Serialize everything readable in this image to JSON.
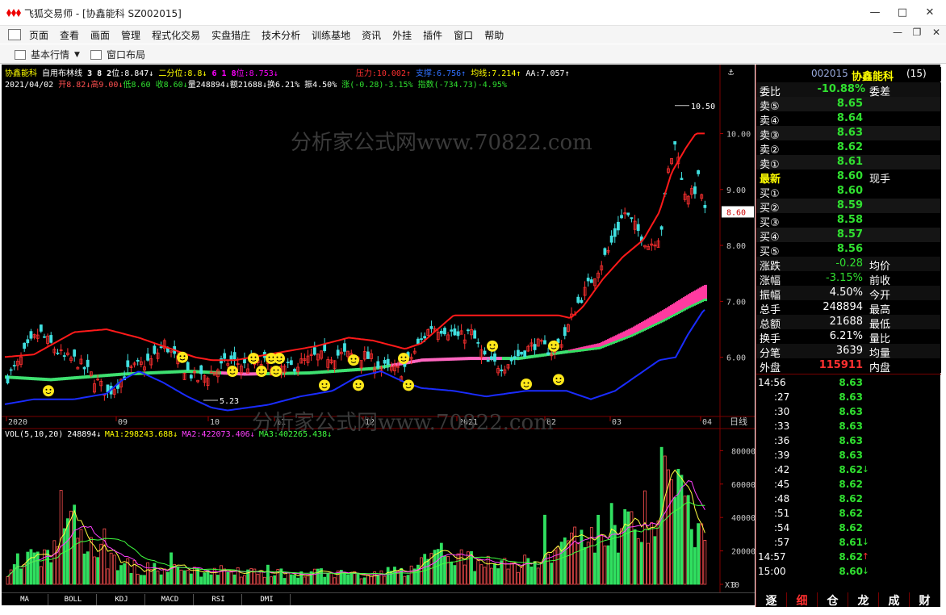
{
  "window": {
    "title": "飞狐交易师 - [协鑫能科 SZ002015]",
    "minimize": "—",
    "maximize": "□",
    "close": "✕",
    "restore": "❐",
    "inner_close": "✕"
  },
  "menu": {
    "items": [
      "页面",
      "查看",
      "画面",
      "管理",
      "程式化交易",
      "实盘猎庄",
      "技术分析",
      "训练基地",
      "资讯",
      "外挂",
      "插件",
      "窗口",
      "帮助"
    ]
  },
  "toolbar": {
    "basic_quote": "基本行情",
    "window_layout": "窗口布局"
  },
  "chart": {
    "info1": {
      "name": "协鑫能科",
      "indicator": "自用布林线",
      "pos1_label": "3 8 2",
      "pos1_value": "位:8.847↓",
      "pos2": "二分位:8.8↓",
      "pos3_label": "6 1 8",
      "pos3_value": "位:8.753↓",
      "pressure": "压力:10.002↑",
      "support": "支撑:6.756↑",
      "ma": "均线:7.214↑",
      "aa": "AA:7.057↑"
    },
    "info2": {
      "date": "2021/04/02",
      "open": "开8.82↓",
      "high": "高9.00↓",
      "low": "低8.60",
      "close": "收8.60↓",
      "volume": "量248894↓",
      "amount": "额21688↓",
      "turnover": "换6.21%",
      "amplitude": "振4.50%",
      "change": "涨(-0.28)-3.15%",
      "index": "指数(-734.73)-4.95%"
    },
    "price_axis": [
      "10.00",
      "9.00",
      "8.00",
      "7.00",
      "6.00"
    ],
    "current_price_tag": "8.60",
    "high_label": "10.50",
    "low_label": "5.23",
    "date_axis": [
      "2020",
      "09",
      "10",
      "11",
      "12",
      "2021",
      "02",
      "03",
      "04"
    ],
    "period_label": "日线",
    "watermark": "分析家公式网www.70822.com",
    "vol_info": {
      "label": "VOL(5,10,20)",
      "value": "248894↓",
      "ma1": "MA1:298243.688↓",
      "ma2": "MA2:422073.406↓",
      "ma3": "MA3:402265.438↓"
    },
    "vol_axis": [
      "80000",
      "60000",
      "40000",
      "20000",
      "0"
    ],
    "vol_unit": "X10",
    "chart_data": {
      "type": "candlestick",
      "ylim": [
        5.0,
        10.8
      ],
      "x_start": "2020",
      "x_end": "2021-04-02",
      "last_close": 8.6,
      "high": 10.5,
      "low": 5.23,
      "band": {
        "upper_last": 10.002,
        "lower_last": 6.756,
        "mid_last": 7.214
      },
      "volume_ylim": [
        0,
        85000
      ]
    }
  },
  "quote": {
    "code": "002015",
    "name": "协鑫能科",
    "count": "(15)",
    "weibi_label": "委比",
    "weibi_value": "-10.88%",
    "weicha_label": "委差",
    "asks": [
      {
        "label": "卖⑤",
        "price": "8.65"
      },
      {
        "label": "卖④",
        "price": "8.64"
      },
      {
        "label": "卖③",
        "price": "8.63"
      },
      {
        "label": "卖②",
        "price": "8.62"
      },
      {
        "label": "卖①",
        "price": "8.61"
      }
    ],
    "latest_label": "最新",
    "latest_price": "8.60",
    "current_hand_label": "现手",
    "bids": [
      {
        "label": "买①",
        "price": "8.60"
      },
      {
        "label": "买②",
        "price": "8.59"
      },
      {
        "label": "买③",
        "price": "8.58"
      },
      {
        "label": "买④",
        "price": "8.57"
      },
      {
        "label": "买⑤",
        "price": "8.56"
      }
    ],
    "stats": [
      {
        "label": "涨跌",
        "value": "-0.28",
        "label2": "均价"
      },
      {
        "label": "涨幅",
        "value": "-3.15%",
        "label2": "前收"
      },
      {
        "label": "振幅",
        "value": "4.50%",
        "label2": "今开"
      },
      {
        "label": "总手",
        "value": "248894",
        "label2": "最高"
      },
      {
        "label": "总额",
        "value": "21688",
        "label2": "最低"
      },
      {
        "label": "换手",
        "value": "6.21%",
        "label2": "量比"
      },
      {
        "label": "分笔",
        "value": "3639",
        "label2": "均量"
      }
    ],
    "outer_label": "外盘",
    "outer_value": "115911",
    "inner_label": "内盘",
    "ticks": [
      {
        "time": "14:56",
        "price": "8.63",
        "flag": ""
      },
      {
        "time": ":27",
        "price": "8.63",
        "flag": ""
      },
      {
        "time": ":30",
        "price": "8.63",
        "flag": ""
      },
      {
        "time": ":33",
        "price": "8.63",
        "flag": ""
      },
      {
        "time": ":36",
        "price": "8.63",
        "flag": ""
      },
      {
        "time": ":39",
        "price": "8.63",
        "flag": ""
      },
      {
        "time": ":42",
        "price": "8.62",
        "flag": "↓"
      },
      {
        "time": ":45",
        "price": "8.62",
        "flag": ""
      },
      {
        "time": ":48",
        "price": "8.62",
        "flag": ""
      },
      {
        "time": ":51",
        "price": "8.62",
        "flag": ""
      },
      {
        "time": ":54",
        "price": "8.62",
        "flag": ""
      },
      {
        "time": ":57",
        "price": "8.61",
        "flag": "↓"
      },
      {
        "time": "14:57",
        "price": "8.62",
        "flag": "↑"
      },
      {
        "time": "15:00",
        "price": "8.60",
        "flag": "↓"
      }
    ]
  },
  "bottom_tabs": [
    "MA",
    "BOLL",
    "KDJ",
    "MACD",
    "RSI",
    "DMI"
  ],
  "right_tabs": [
    "逐",
    "细",
    "仓",
    "龙",
    "成",
    "财"
  ]
}
